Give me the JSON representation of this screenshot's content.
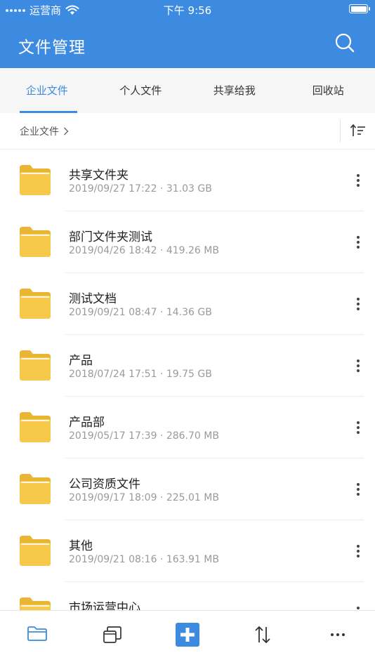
{
  "status_bar": {
    "carrier": "运营商",
    "time": "下午 9:56"
  },
  "header": {
    "title": "文件管理"
  },
  "tabs": [
    {
      "label": "企业文件",
      "active": true
    },
    {
      "label": "个人文件",
      "active": false
    },
    {
      "label": "共享给我",
      "active": false
    },
    {
      "label": "回收站",
      "active": false
    }
  ],
  "breadcrumb": {
    "label": "企业文件"
  },
  "files": [
    {
      "name": "共享文件夹",
      "meta": "2019/09/27 17:22 · 31.03 GB"
    },
    {
      "name": "部门文件夹测试",
      "meta": "2019/04/26 18:42 · 419.26 MB"
    },
    {
      "name": "测试文档",
      "meta": "2019/09/21 08:47 · 14.36 GB"
    },
    {
      "name": "产品",
      "meta": "2018/07/24 17:51 · 19.75 GB"
    },
    {
      "name": "产品部",
      "meta": "2019/05/17 17:39 · 286.70 MB"
    },
    {
      "name": "公司资质文件",
      "meta": "2019/09/17 18:09 · 225.01 MB"
    },
    {
      "name": "其他",
      "meta": "2019/09/21 08:16 · 163.91 MB"
    },
    {
      "name": "市场运营中心",
      "meta": ""
    }
  ],
  "colors": {
    "accent": "#3d8be0",
    "folder": "#f7c94b",
    "folder_dark": "#eab532"
  },
  "bottom_bar": [
    "folder-icon",
    "windows-icon",
    "add-icon",
    "transfer-icon",
    "more-icon"
  ]
}
